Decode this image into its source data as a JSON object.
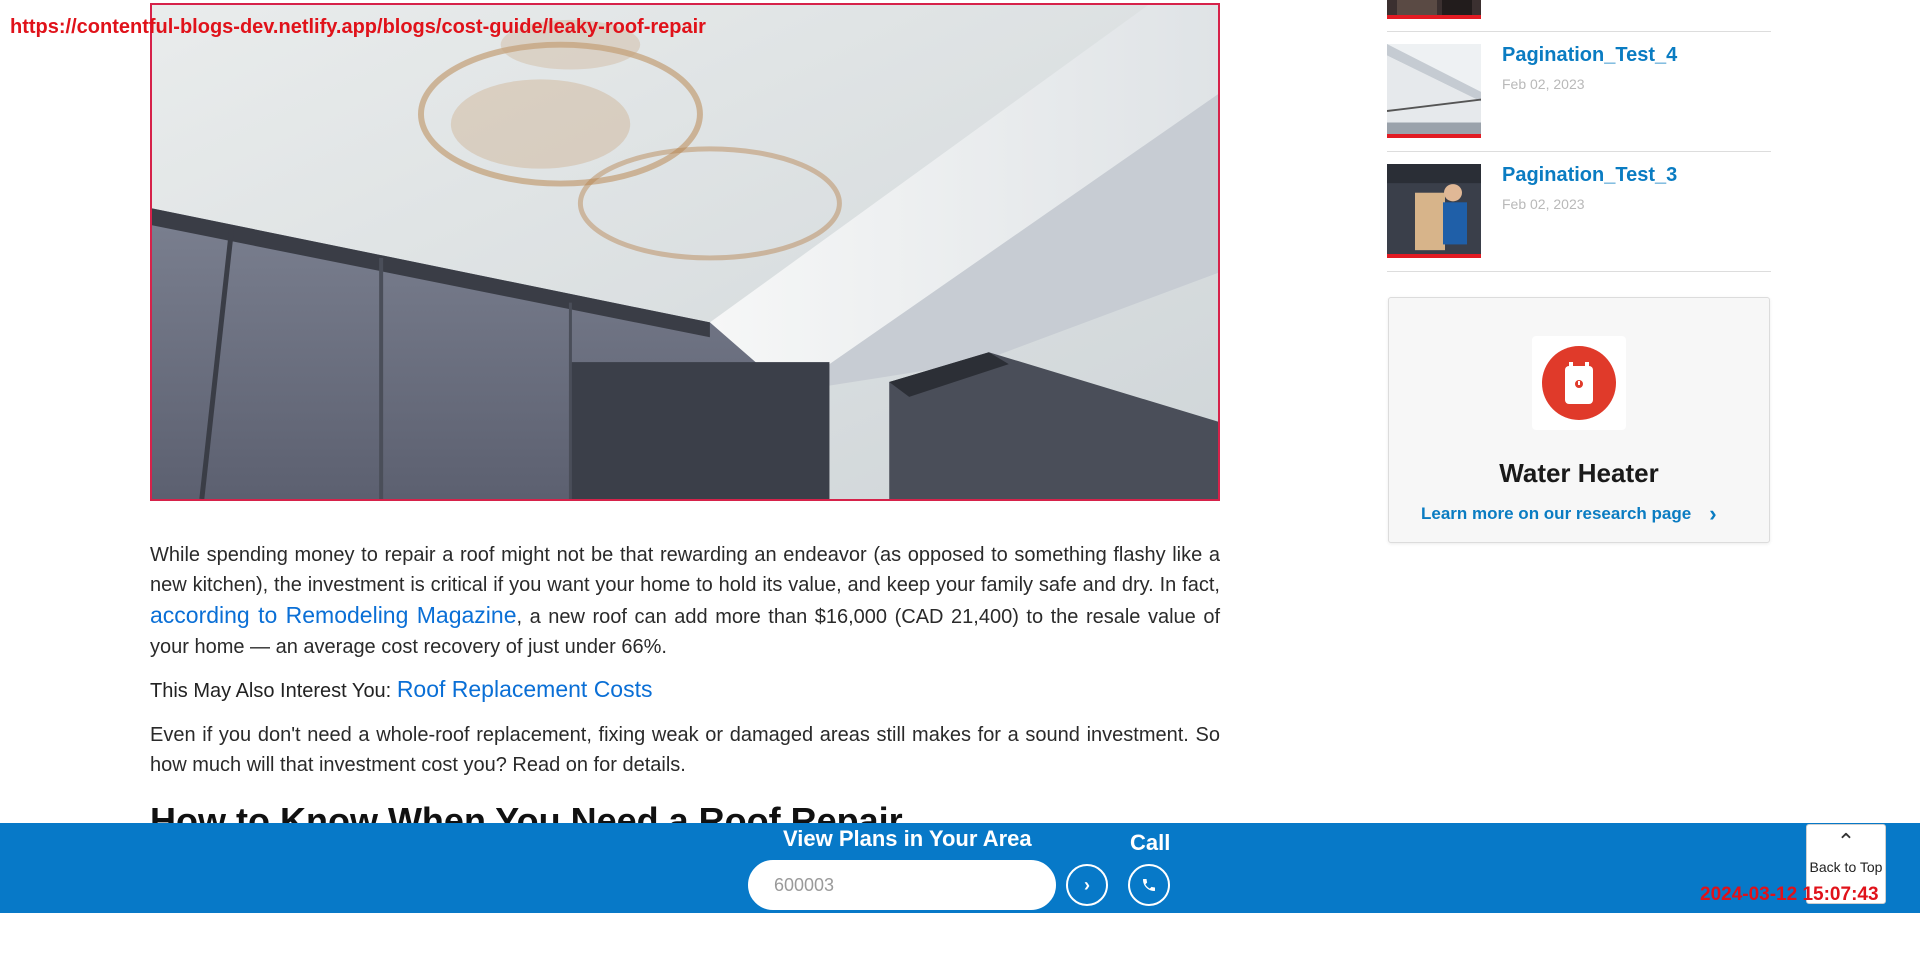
{
  "url_overlay": "https://contentful-blogs-dev.netlify.app/blogs/cost-guide/leaky-roof-repair",
  "article": {
    "hero_alt": "Water-stained ceiling above kitchen cabinets",
    "p1_before": "While spending money to repair a roof might not be that rewarding an endeavor (as opposed to something flashy like a new kitchen), the investment is critical if you want your home to hold its value, and keep your family safe and dry. In fact,",
    "p1_link": "according to Remodeling Magazine",
    "p1_after": ", a new roof can add more than $16,000 (CAD 21,400) to the resale value of your home — an average cost recovery of just under 66%.",
    "interest_lead": "This May Also Interest You:",
    "interest_link": "Roof Replacement Costs",
    "p2": "Even if you don't need a whole-roof replacement, fixing weak or damaged areas still makes for a sound investment. So how much will that investment cost you? Read on for details.",
    "next_heading": "How to Know When You Need a Roof Repair"
  },
  "sidebar": {
    "items": [
      {
        "title": "Pagination_Test_4",
        "date": "Feb 02, 2023"
      },
      {
        "title": "Pagination_Test_3",
        "date": "Feb 02, 2023"
      }
    ],
    "card": {
      "icon": "water-heater-icon",
      "title": "Water Heater",
      "link": "Learn more on our research page"
    }
  },
  "bottom_bar": {
    "label": "View Plans in Your Area",
    "zip_value": "600003",
    "call_label": "Call",
    "back_to_top": "Back to Top"
  },
  "timestamp": "2024-03-12 15:07:43",
  "colors": {
    "accent_blue": "#0779c8",
    "link_blue": "#0a6fd6",
    "red": "#e0121a"
  }
}
